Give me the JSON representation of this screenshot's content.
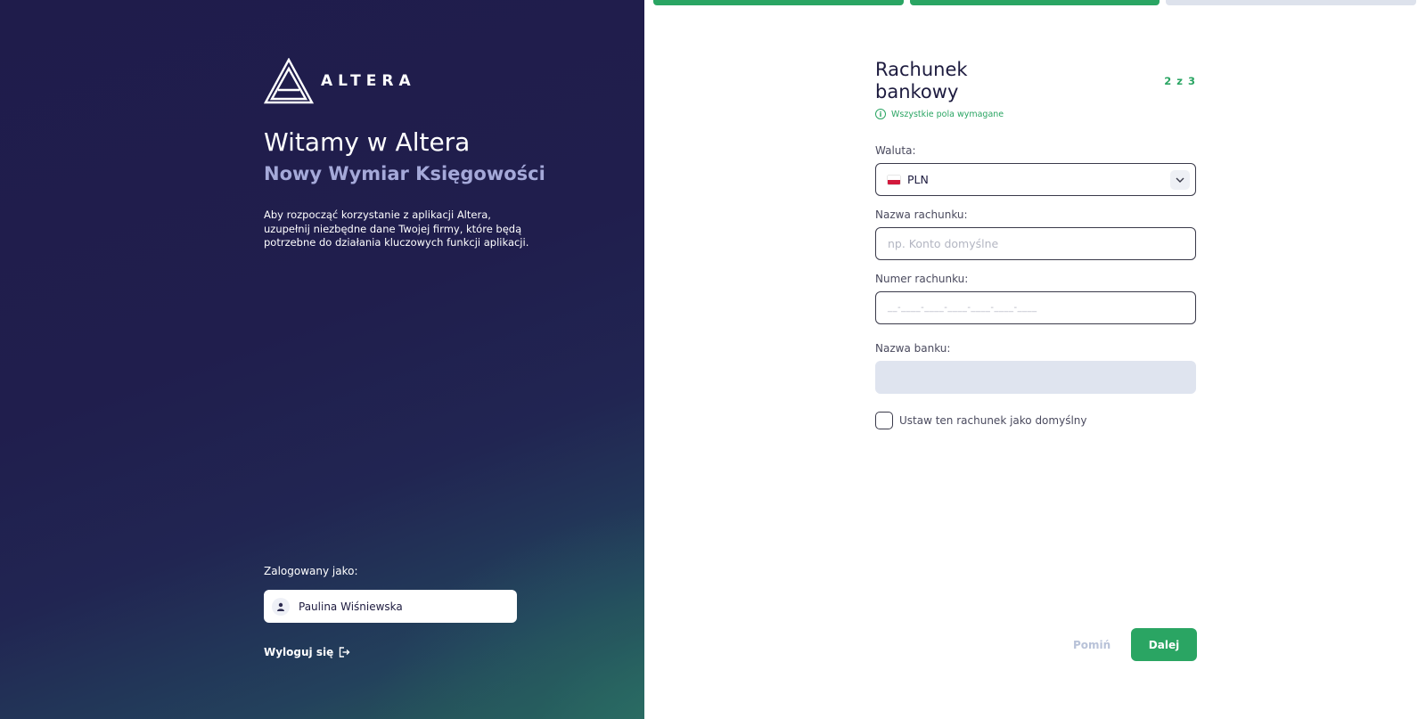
{
  "brand": {
    "name": "ALTERA",
    "accent": "#2aa563",
    "panel_color": "#201e4d"
  },
  "left": {
    "welcome": "Witamy w Altera",
    "subtitle": "Nowy Wymiar Księgowości",
    "intro": "Aby rozpocząć korzystanie z aplikacji Altera, uzupełnij niezbędne dane Twojej firmy, które będą potrzebne do działania kluczowych funkcji aplikacji.",
    "logged_as_label": "Zalogowany jako:",
    "user_name": "Paulina Wiśniewska",
    "logout_label": "Wyloguj się"
  },
  "progress": {
    "steps_total": 3,
    "steps_done": 2,
    "done_color": "#2aa563",
    "pending_color": "#dde2ec"
  },
  "form": {
    "title": "Rachunek bankowy",
    "step_label": "2 z 3",
    "required_note": "Wszystkie pola wymagane",
    "currency": {
      "label": "Waluta:",
      "value": "PLN",
      "icon": "poland-flag-icon"
    },
    "account_name": {
      "label": "Nazwa rachunku:",
      "placeholder": "np. Konto domyślne"
    },
    "account_number": {
      "label": "Numer rachunku:",
      "placeholder": "__-____-____-____-____-____-____"
    },
    "bank_name": {
      "label": "Nazwa banku:",
      "value": ""
    },
    "default_checkbox": {
      "label": "Ustaw ten rachunek jako domyślny",
      "checked": false
    }
  },
  "actions": {
    "skip_label": "Pomiń",
    "next_label": "Dalej"
  }
}
